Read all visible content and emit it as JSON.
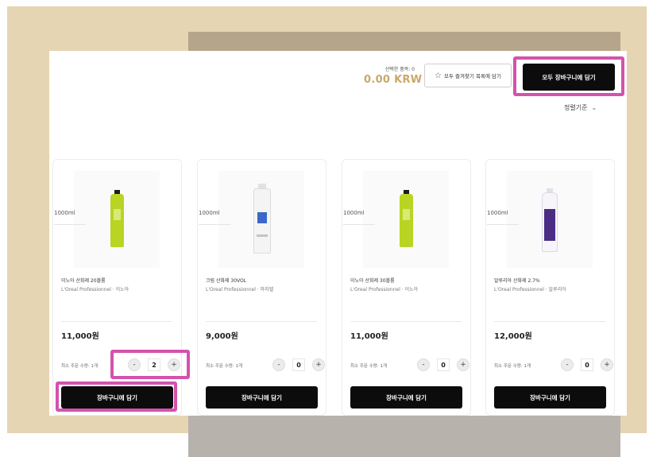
{
  "header": {
    "selected_label": "선택한 품목: 0",
    "selected_total": "0.00 KRW",
    "favorite_button_label": "모두 즐겨찾기 목록에 담기",
    "add_all_to_cart_label": "모두 장바구니에 담기",
    "sort_label": "정렬기준"
  },
  "products": [
    {
      "volume": "1000ml",
      "name": "이노아 산화제 20볼륨",
      "brand": "L'Oreal Professionnel · 이노아",
      "price": "11,000원",
      "min_order": "최소 주문 수량: 1개",
      "quantity": "2",
      "cart_label": "장바구니에 담기",
      "bottle_icon": "lime-developer-bottle-icon",
      "bottle_color": "#b9d422"
    },
    {
      "volume": "1000ml",
      "name": "크림 산화제 30VOL",
      "brand": "L'Oreal Professionnel · 마지렐",
      "price": "9,000원",
      "min_order": "최소 주문 수량: 1개",
      "quantity": "0",
      "cart_label": "장바구니에 담기",
      "bottle_icon": "white-developer-bottle-icon",
      "bottle_color": "#f4f4f4"
    },
    {
      "volume": "1000ml",
      "name": "이노아 산화제 30볼륨",
      "brand": "L'Oreal Professionnel · 이노아",
      "price": "11,000원",
      "min_order": "최소 주문 수량: 1개",
      "quantity": "0",
      "cart_label": "장바구니에 담기",
      "bottle_icon": "lime-developer-bottle-icon",
      "bottle_color": "#b9d422"
    },
    {
      "volume": "1000ml",
      "name": "알루리아 산화제 2.7%",
      "brand": "L'Oreal Professionnel · 알루리아",
      "price": "12,000원",
      "min_order": "최소 주문 수량: 1개",
      "quantity": "0",
      "cart_label": "장바구니에 담기",
      "bottle_icon": "white-purple-developer-bottle-icon",
      "bottle_color": "#f7f5fa"
    }
  ],
  "icons": {
    "favorite": "star-add-icon",
    "sort": "chevron-down-icon",
    "minus": "minus-icon",
    "plus": "plus-icon"
  },
  "colors": {
    "price_accent": "#c9a86a",
    "button_dark": "#0c0c0c",
    "highlight": "#d452ad",
    "backdrop_beige": "#e6d5b3"
  }
}
